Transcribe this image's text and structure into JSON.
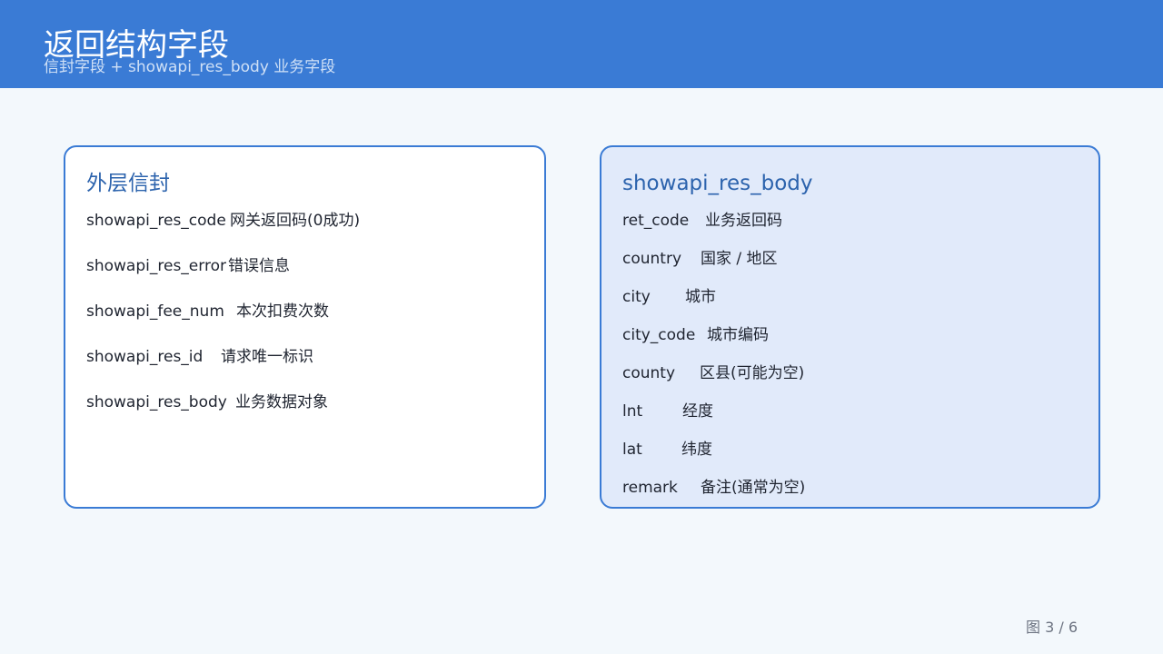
{
  "header": {
    "title": "返回结构字段",
    "subtitle": "信封字段 + showapi_res_body 业务字段"
  },
  "left_card": {
    "title": "外层信封",
    "rows": [
      {
        "field": "showapi_res_code",
        "desc": "网关返回码(0成功)"
      },
      {
        "field": "showapi_res_error",
        "desc": "错误信息"
      },
      {
        "field": "showapi_fee_num",
        "desc": "本次扣费次数"
      },
      {
        "field": "showapi_res_id",
        "desc": "请求唯一标识"
      },
      {
        "field": "showapi_res_body",
        "desc": "业务数据对象"
      }
    ]
  },
  "right_card": {
    "title": "showapi_res_body",
    "rows": [
      {
        "field": "ret_code",
        "desc": "业务返回码"
      },
      {
        "field": "country",
        "desc": "国家 / 地区"
      },
      {
        "field": "city",
        "desc": "城市"
      },
      {
        "field": "city_code",
        "desc": "城市编码"
      },
      {
        "field": "county",
        "desc": "区县(可能为空)"
      },
      {
        "field": "lnt",
        "desc": "经度"
      },
      {
        "field": "lat",
        "desc": "纬度"
      },
      {
        "field": "remark",
        "desc": "备注(通常为空)"
      }
    ]
  },
  "footer": {
    "page_indicator": "图 3 / 6"
  },
  "colors": {
    "header_bg": "#3a7bd5",
    "accent": "#2c63ad",
    "right_card_bg": "#e1eafa",
    "page_bg": "#f3f8fc"
  }
}
